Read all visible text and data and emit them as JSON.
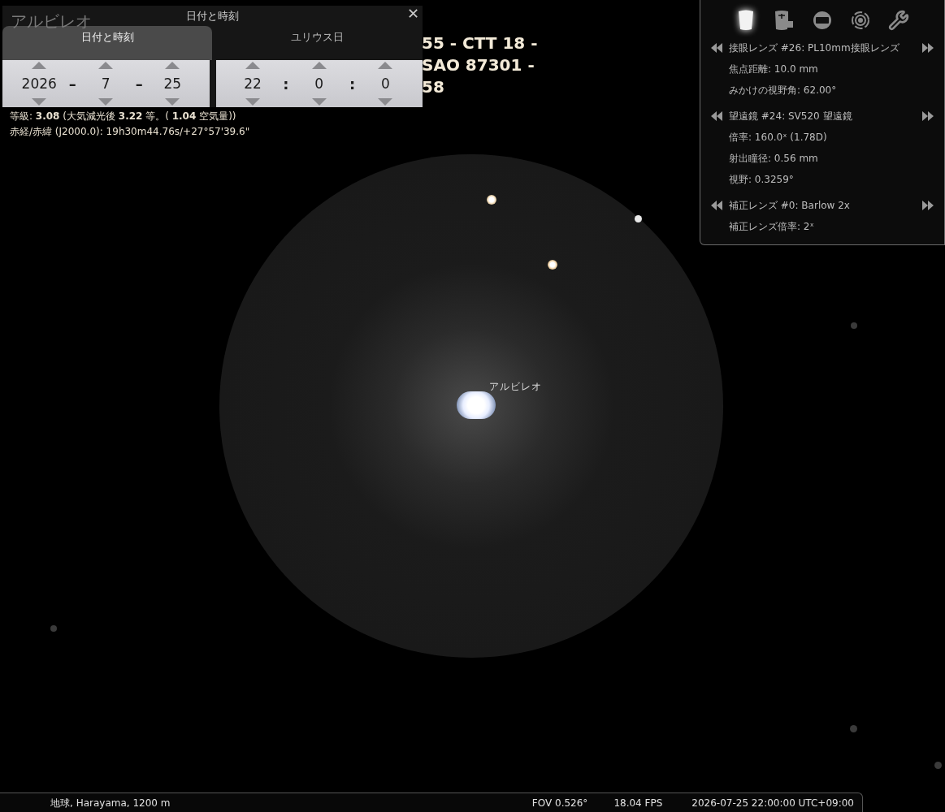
{
  "object_title": "アルビレオ",
  "designations": [
    "55 - CTT 18 -",
    "SAO 87301 -",
    "58"
  ],
  "info_lines": [
    "等級: **3.08** (大気減光後 **3.22** 等。( **1.04** 空気量))",
    "赤経/赤緯 (J2000.0): 19h30m44.76s/+27°57'39.6\""
  ],
  "date_dialog": {
    "title": "日付と時刻",
    "close": "✕",
    "tabs": [
      {
        "label": "日付と時刻",
        "selected": true
      },
      {
        "label": "ユリウス日",
        "selected": false
      }
    ],
    "date_fields": [
      {
        "kind": "number",
        "value": "2026"
      },
      {
        "kind": "separator",
        "value": "–"
      },
      {
        "kind": "number",
        "value": "7"
      },
      {
        "kind": "separator",
        "value": "–"
      },
      {
        "kind": "number",
        "value": "25"
      }
    ],
    "time_fields": [
      {
        "kind": "number",
        "value": "22"
      },
      {
        "kind": "separator",
        "value": ":"
      },
      {
        "kind": "number",
        "value": "0"
      },
      {
        "kind": "separator",
        "value": ":"
      },
      {
        "kind": "number",
        "value": "0"
      }
    ]
  },
  "star_label": "アルビレオ",
  "oculars_panel": {
    "tools": [
      {
        "kind": "eyepiece",
        "selected": true
      },
      {
        "kind": "lens",
        "selected": false
      },
      {
        "kind": "sensor",
        "selected": false
      },
      {
        "kind": "target",
        "selected": false
      },
      {
        "kind": "wrench",
        "selected": false
      }
    ],
    "sections": [
      {
        "heading": "接眼レンズ #26: PL10mm接眼レンズ",
        "lines": [
          "焦点距離: 10.0 mm",
          "みかけの視野角: 62.00°"
        ]
      },
      {
        "heading": "望遠鏡 #24: SV520 望遠鏡",
        "lines": [
          "倍率: 160.0ˣ (1.78D)",
          "射出瞳径: 0.56 mm",
          "視野: 0.3259°"
        ]
      },
      {
        "heading": "補正レンズ #0: Barlow 2x",
        "lines": [
          "補正レンズ倍率: 2ˣ"
        ]
      }
    ]
  },
  "status_bar": {
    "location": "地球, Harayama, 1200 m",
    "fov": "FOV 0.526°",
    "fps": "18.04 FPS",
    "datetime": "2026-07-25 22:00:00 UTC+09:00"
  }
}
